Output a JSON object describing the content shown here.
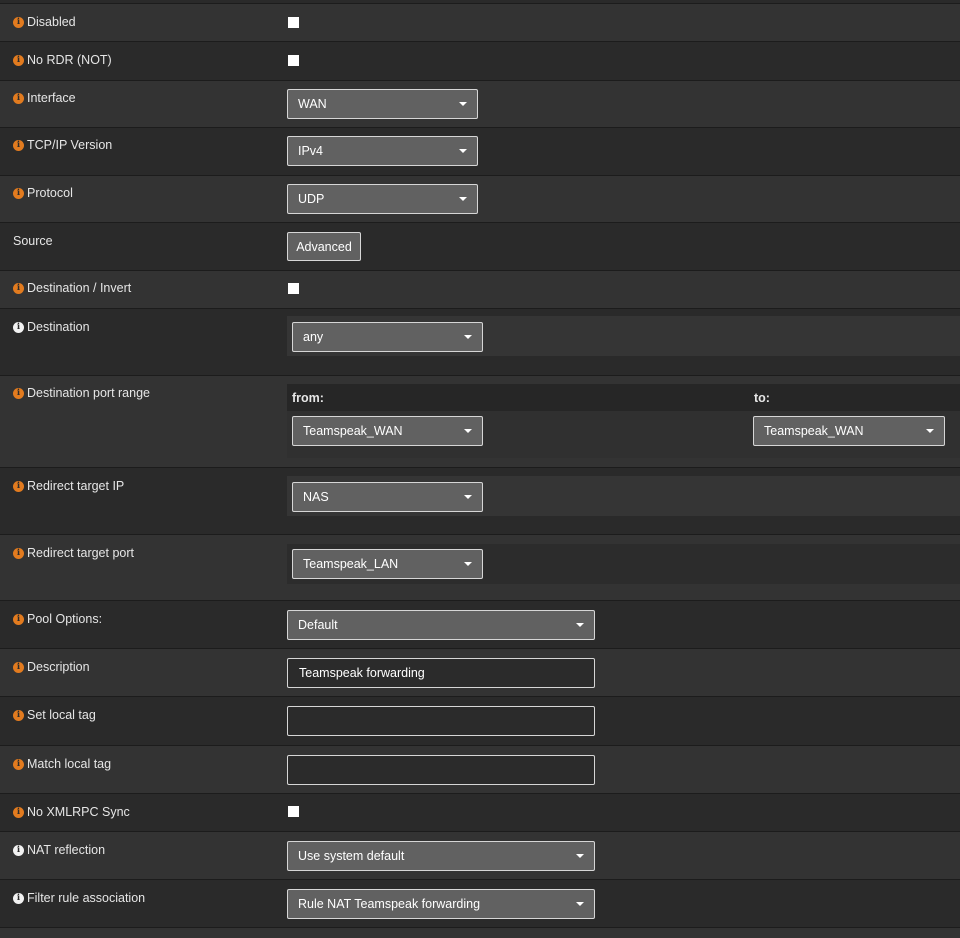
{
  "fields": {
    "disabled": {
      "label": "Disabled",
      "checked": false
    },
    "no_rdr": {
      "label": "No RDR (NOT)",
      "checked": false
    },
    "interface": {
      "label": "Interface",
      "value": "WAN"
    },
    "tcpip_version": {
      "label": "TCP/IP Version",
      "value": "IPv4"
    },
    "protocol": {
      "label": "Protocol",
      "value": "UDP"
    },
    "source": {
      "label": "Source",
      "button": "Advanced"
    },
    "destination_invert": {
      "label": "Destination / Invert",
      "checked": false
    },
    "destination": {
      "label": "Destination",
      "value": "any"
    },
    "destination_port_range": {
      "label": "Destination port range",
      "from_label": "from:",
      "from_value": "Teamspeak_WAN",
      "to_label": "to:",
      "to_value": "Teamspeak_WAN"
    },
    "redirect_target_ip": {
      "label": "Redirect target IP",
      "value": "NAS"
    },
    "redirect_target_port": {
      "label": "Redirect target port",
      "value": "Teamspeak_LAN"
    },
    "pool_options": {
      "label": "Pool Options:",
      "value": "Default"
    },
    "description": {
      "label": "Description",
      "value": "Teamspeak forwarding"
    },
    "set_local_tag": {
      "label": "Set local tag",
      "value": ""
    },
    "match_local_tag": {
      "label": "Match local tag",
      "value": ""
    },
    "no_xmlrpc_sync": {
      "label": "No XMLRPC Sync",
      "checked": false
    },
    "nat_reflection": {
      "label": "NAT reflection",
      "value": "Use system default"
    },
    "filter_rule_association": {
      "label": "Filter rule association",
      "value": "Rule NAT Teamspeak forwarding"
    }
  },
  "colors": {
    "accent_info": "#e27b1f",
    "info_white": "#f2f2f2",
    "row_dark": "#2a2a2a",
    "row_light": "#333333"
  },
  "icons": {
    "info": "info-circle-icon",
    "dropdown": "caret-down-icon"
  }
}
